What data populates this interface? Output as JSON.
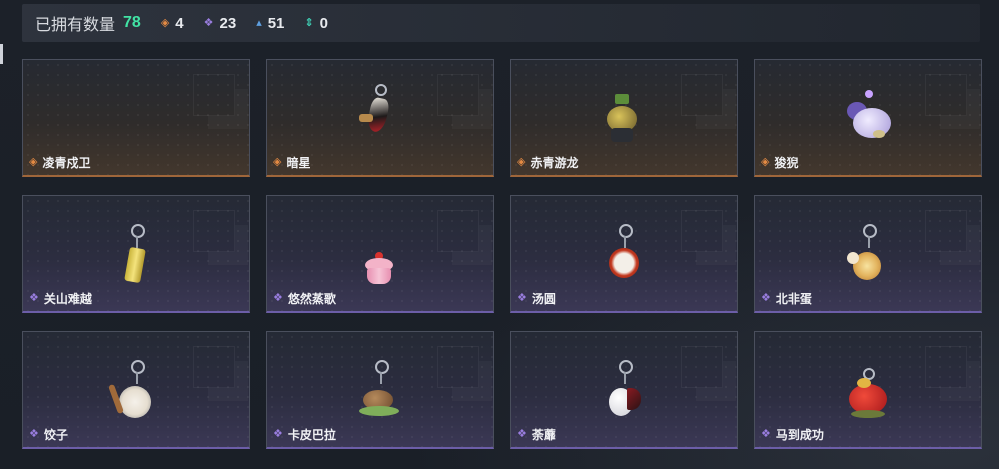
{
  "header": {
    "owned_label": "已拥有数量",
    "owned_count": "78",
    "stats": [
      {
        "icon": "orange-diamond-icon",
        "value": "4"
      },
      {
        "icon": "purple-diamond-icon",
        "value": "23"
      },
      {
        "icon": "blue-chevron-icon",
        "value": "51"
      },
      {
        "icon": "teal-arrows-icon",
        "value": "0"
      }
    ]
  },
  "colors": {
    "owned_count": "#41e3a4",
    "rarity_orange": "#e48a43",
    "rarity_purple": "#9a7ee0"
  },
  "items": [
    {
      "name": "凌青戍卫",
      "rarity": "orange"
    },
    {
      "name": "暗星",
      "rarity": "orange"
    },
    {
      "name": "赤青游龙",
      "rarity": "orange"
    },
    {
      "name": "狻猊",
      "rarity": "orange"
    },
    {
      "name": "关山难越",
      "rarity": "purple"
    },
    {
      "name": "悠然蒸歌",
      "rarity": "purple"
    },
    {
      "name": "汤圆",
      "rarity": "purple"
    },
    {
      "name": "北非蛋",
      "rarity": "purple"
    },
    {
      "name": "饺子",
      "rarity": "purple"
    },
    {
      "name": "卡皮巴拉",
      "rarity": "purple"
    },
    {
      "name": "荼蘼",
      "rarity": "purple"
    },
    {
      "name": "马到成功",
      "rarity": "purple"
    }
  ]
}
